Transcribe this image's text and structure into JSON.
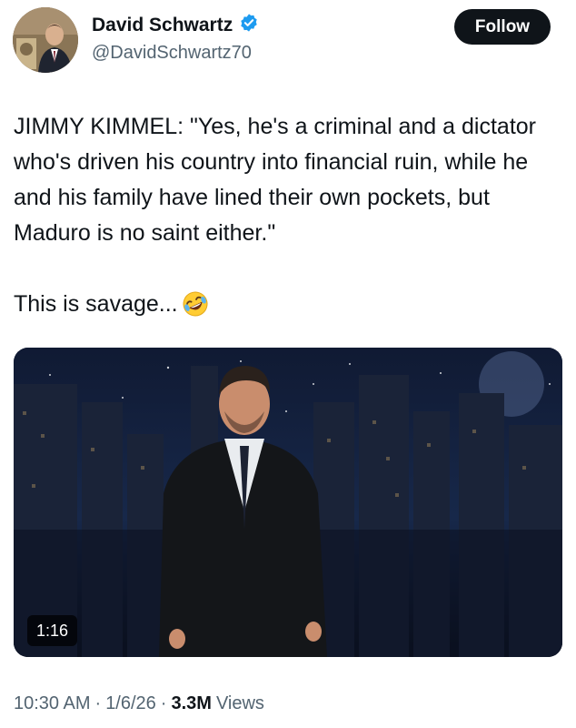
{
  "author": {
    "display_name": "David Schwartz",
    "handle": "@DavidSchwartz70",
    "verified_badge_icon": "verified-badge-icon",
    "verified_color": "#1d9bf0",
    "avatar_icon": "user-avatar"
  },
  "follow_button": {
    "label": "Follow"
  },
  "tweet": {
    "paragraphs": [
      "JIMMY KIMMEL: \"Yes, he's a criminal and a dictator who's driven his country into financial ruin, while he and his family have lined their own pockets, but Maduro is no saint either.\"",
      "This is savage..."
    ],
    "emoji_icon": "rolling-on-floor-laughing-emoji"
  },
  "media": {
    "type": "video",
    "duration": "1:16"
  },
  "footer": {
    "time": "10:30 AM",
    "separator": "·",
    "date": "1/6/26",
    "views_count": "3.3M",
    "views_label": "Views"
  }
}
